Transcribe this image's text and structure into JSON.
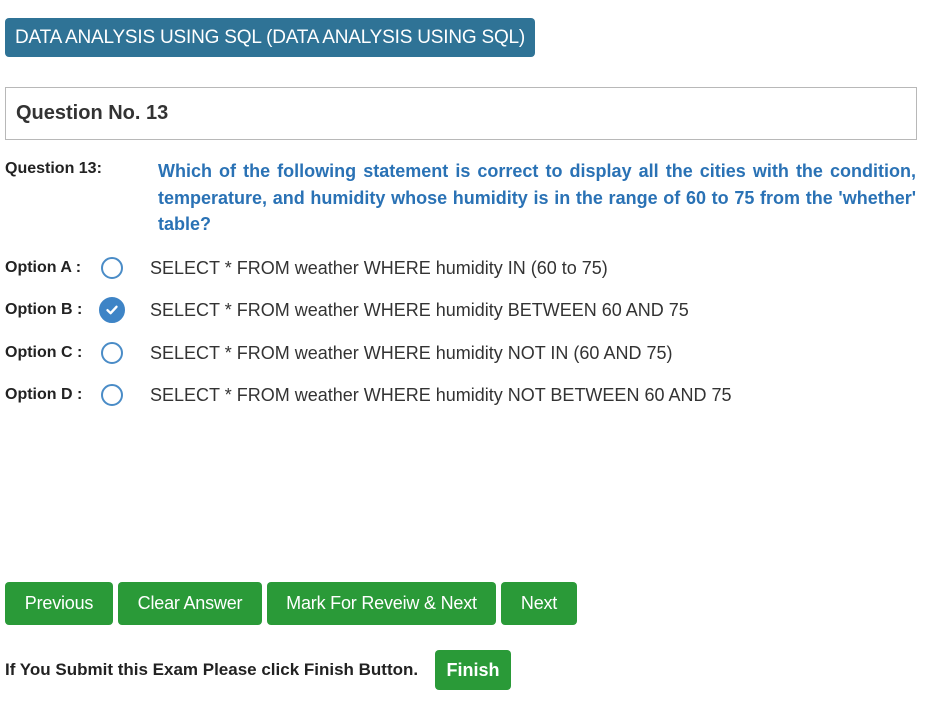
{
  "subject": {
    "title": "DATA ANALYSIS USING SQL (DATA ANALYSIS USING SQL)"
  },
  "question": {
    "header": "Question No. 13",
    "label": "Question 13:",
    "text": "Which of the following statement is correct to display all the cities with the condition, temperature, and humidity whose humidity is in the range of 60 to 75 from the 'whether' table?"
  },
  "options": [
    {
      "label": "Option A :",
      "text": "SELECT * FROM weather WHERE humidity IN (60 to 75)",
      "selected": false
    },
    {
      "label": "Option B :",
      "text": "SELECT * FROM weather WHERE humidity BETWEEN 60 AND 75",
      "selected": true
    },
    {
      "label": "Option C :",
      "text": "SELECT * FROM weather WHERE humidity NOT IN (60 AND 75)",
      "selected": false
    },
    {
      "label": "Option D :",
      "text": "SELECT * FROM weather WHERE humidity NOT BETWEEN 60 AND 75",
      "selected": false
    }
  ],
  "buttons": {
    "previous": "Previous",
    "clear": "Clear Answer",
    "mark_review": "Mark For Reveiw & Next",
    "next": "Next",
    "finish": "Finish"
  },
  "finish_note": "If You Submit this Exam Please click Finish Button.",
  "colors": {
    "header_blue": "#2f7396",
    "question_blue": "#2a72b5",
    "radio_blue": "#3e84c6",
    "button_green": "#2a9a38"
  }
}
